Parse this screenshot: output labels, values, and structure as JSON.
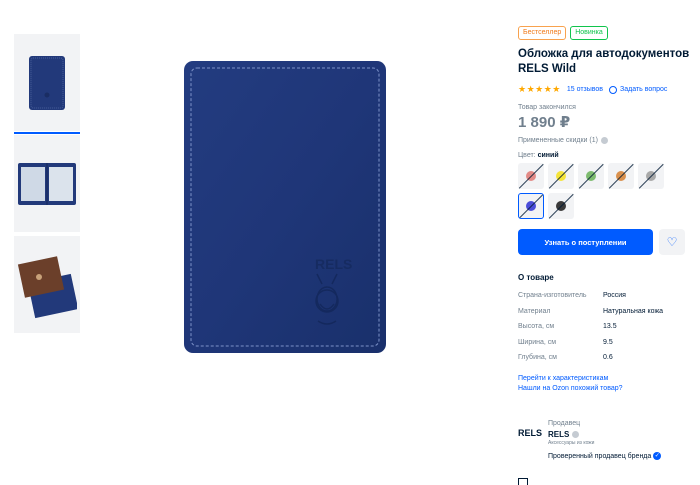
{
  "badges": {
    "bestseller": "Бестселлер",
    "new": "Новинка"
  },
  "product": {
    "title": "Обложка для автодокументов RELS Wild",
    "stars": "★★★★★",
    "reviews": "15 отзывов",
    "ask": "Задать вопрос",
    "stock_status": "Товар закончился",
    "price": "1 890 ₽",
    "discounts": "Примененные скидки (1)",
    "color_label": "Цвет:",
    "color_value": "синий"
  },
  "swatches": [
    {
      "color": "#e28a86"
    },
    {
      "color": "#f5e43a"
    },
    {
      "color": "#7dbb6e"
    },
    {
      "color": "#d9904d"
    },
    {
      "color": "#a8a8a8"
    },
    {
      "color": "#4b4dd9"
    },
    {
      "color": "#3a3a3a"
    }
  ],
  "actions": {
    "notify": "Узнать о поступлении",
    "favorite_icon": "heart-icon"
  },
  "about": {
    "title": "О товаре",
    "specs": [
      {
        "k": "Страна-изготовитель",
        "v": "Россия"
      },
      {
        "k": "Материал",
        "v": "Натуральная кожа"
      },
      {
        "k": "Высота, см",
        "v": "13.5"
      },
      {
        "k": "Ширина, см",
        "v": "9.5"
      },
      {
        "k": "Глубина, см",
        "v": "0.6"
      }
    ],
    "link_specs": "Перейти к характеристикам",
    "link_similar": "Нашли на Ozon похожий товар?"
  },
  "seller": {
    "logo": "RELS",
    "label": "Продавец",
    "name": "RELS",
    "sub": "Аксессуары из кожи",
    "verified": "Проверенный продавец бренда"
  },
  "colors": {
    "accent": "#005bff",
    "wallet": "#22397a"
  }
}
